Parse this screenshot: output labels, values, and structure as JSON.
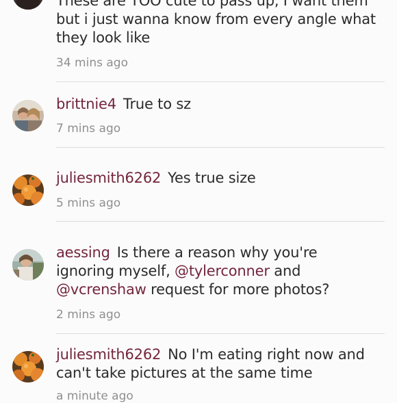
{
  "comments": [
    {
      "username": "",
      "text": "These are TOO cute to pass up, I want them but i just wanna know from every angle what they look like",
      "time": "34 mins ago",
      "avatar": "dark-avatar"
    },
    {
      "username": "brittnie4",
      "text": "True to sz",
      "time": "7 mins ago",
      "avatar": "family-photo-avatar"
    },
    {
      "username": "juliesmith6262",
      "text": "Yes true size",
      "time": "5 mins ago",
      "avatar": "oranges-avatar"
    },
    {
      "username": "aessing",
      "text_before": "Is there a reason why you're ignoring myself,",
      "mention1": "@tylerconner",
      "text_middle": "and",
      "mention2": "@vcrenshaw",
      "text_after": "request for more photos?",
      "time": "2 mins ago",
      "avatar": "person-photo-avatar"
    },
    {
      "username": "juliesmith6262",
      "text": "No I'm eating right now and can't take pictures at the same time",
      "time": "a minute ago",
      "avatar": "oranges-avatar"
    }
  ],
  "colors": {
    "username": "#73263d",
    "timestamp": "#8f8f8f",
    "divider": "#dcdcdc",
    "background": "#fcfbfc"
  }
}
